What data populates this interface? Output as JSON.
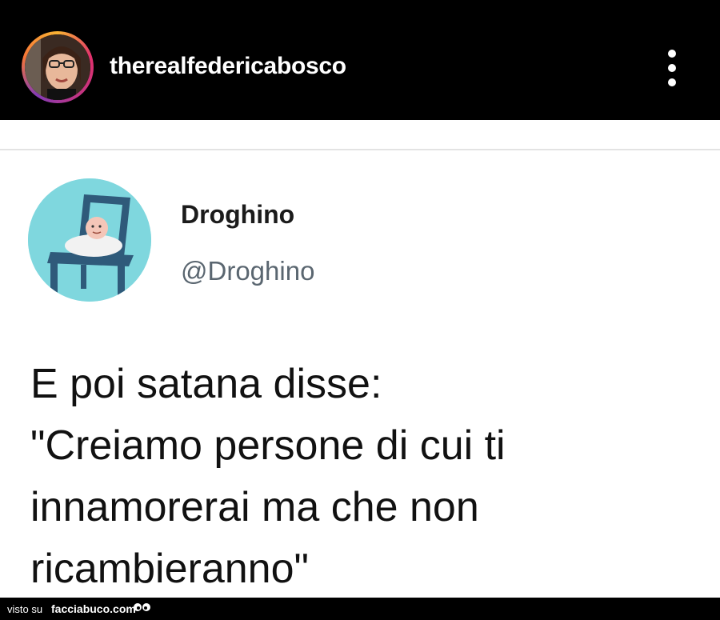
{
  "header": {
    "username": "therealfedericabosco",
    "avatar_icon": "profile-photo",
    "more_icon": "vertical-dots-icon"
  },
  "tweet": {
    "display_name": "Droghino",
    "handle": "@Droghino",
    "avatar_icon": "baby-on-chair-illustration",
    "lines": [
      "E poi satana disse:",
      "\"Creiamo persone di cui ti",
      "innamorerai ma che non",
      "ricambieranno\""
    ]
  },
  "footer": {
    "prefix": "visto su",
    "site": "facciabuco.com",
    "logo_icon": "eyes-icon"
  },
  "colors": {
    "header_bg": "#000000",
    "post_bg": "#ffffff",
    "avatar_bg": "#7fd7de",
    "chair": "#2f5a7a",
    "handle": "#5a6670"
  }
}
